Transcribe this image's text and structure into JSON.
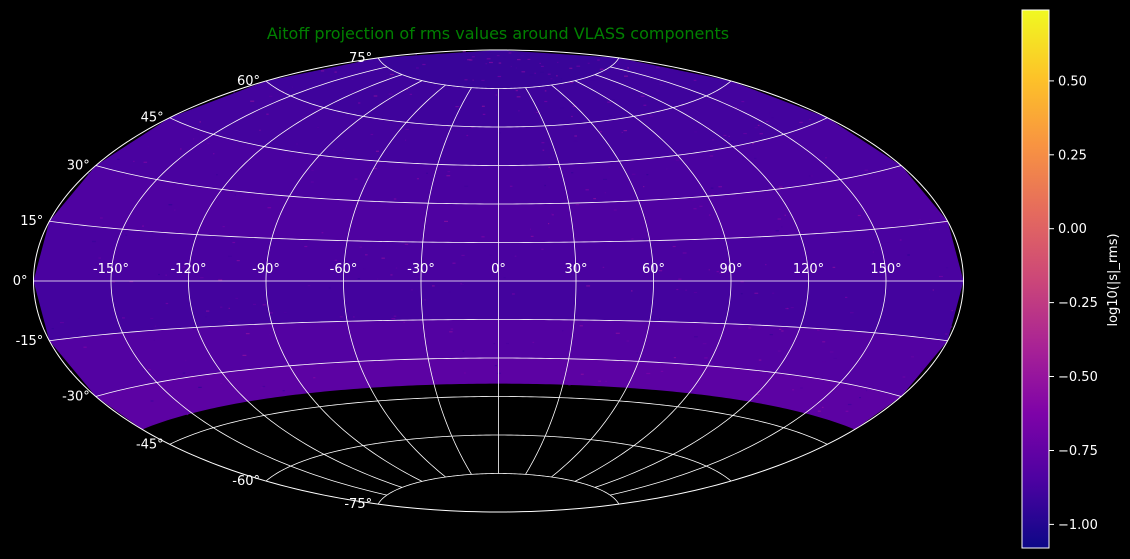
{
  "chart_data": {
    "type": "heatmap",
    "projection": "aitoff",
    "title": "Aitoff projection of rms values around VLASS components",
    "title_color": "#008000",
    "background": "#000000",
    "grid": true,
    "grid_color": "#ffffff",
    "longitude_ticks": [
      -150,
      -120,
      -90,
      -60,
      -30,
      0,
      30,
      60,
      90,
      120,
      150
    ],
    "longitude_tick_labels": [
      "-150°",
      "-120°",
      "-90°",
      "-60°",
      "-30°",
      "0°",
      "30°",
      "60°",
      "90°",
      "120°",
      "150°"
    ],
    "latitude_ticks": [
      -75,
      -60,
      -45,
      -30,
      -15,
      0,
      15,
      30,
      45,
      60,
      75
    ],
    "latitude_tick_labels": [
      "-75°",
      "-60°",
      "-45°",
      "-30°",
      "-15°",
      "0°",
      "15°",
      "30°",
      "45°",
      "60°",
      "75°"
    ],
    "data_coverage_dec_min": -40,
    "colorbar": {
      "label": "log10(|s|_rms)",
      "colormap": "plasma",
      "range": [
        -1.08,
        0.74
      ],
      "ticks": [
        0.5,
        0.25,
        0.0,
        -0.25,
        -0.5,
        -0.75,
        -1.0
      ],
      "tick_labels": [
        "0.50",
        "0.25",
        "0.00",
        "−0.25",
        "−0.50",
        "−0.75",
        "−1.00"
      ]
    },
    "sky_bands": [
      {
        "dec": [
          -40,
          -30
        ],
        "value": -0.78
      },
      {
        "dec": [
          -30,
          -15
        ],
        "value": -0.82
      },
      {
        "dec": [
          -15,
          0
        ],
        "value": -0.88
      },
      {
        "dec": [
          0,
          15
        ],
        "value": -0.86
      },
      {
        "dec": [
          15,
          30
        ],
        "value": -0.84
      },
      {
        "dec": [
          30,
          45
        ],
        "value": -0.86
      },
      {
        "dec": [
          45,
          60
        ],
        "value": -0.88
      },
      {
        "dec": [
          60,
          75
        ],
        "value": -0.9
      },
      {
        "dec": [
          75,
          90
        ],
        "value": -0.92
      }
    ]
  }
}
